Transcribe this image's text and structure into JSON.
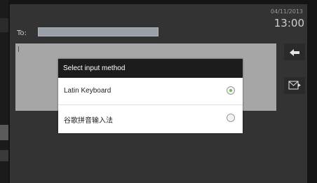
{
  "status": {
    "date": "04/11/2013",
    "time": "13:00"
  },
  "compose": {
    "to_label": "To:",
    "to_value": "",
    "body_value": ""
  },
  "icons": {
    "to_dropdown": "chevron-down-icon",
    "back": "back-arrow-icon",
    "send_mail": "send-mail-icon"
  },
  "dialog": {
    "title": "Select input method",
    "options": [
      {
        "label": "Latin Keyboard",
        "selected": true
      },
      {
        "label": "谷歌拼音输入法",
        "selected": false
      }
    ]
  },
  "colors": {
    "dialog_header": "#1c1c1c",
    "selected_radio": "#7ab84a",
    "screen_bg": "#333333"
  }
}
